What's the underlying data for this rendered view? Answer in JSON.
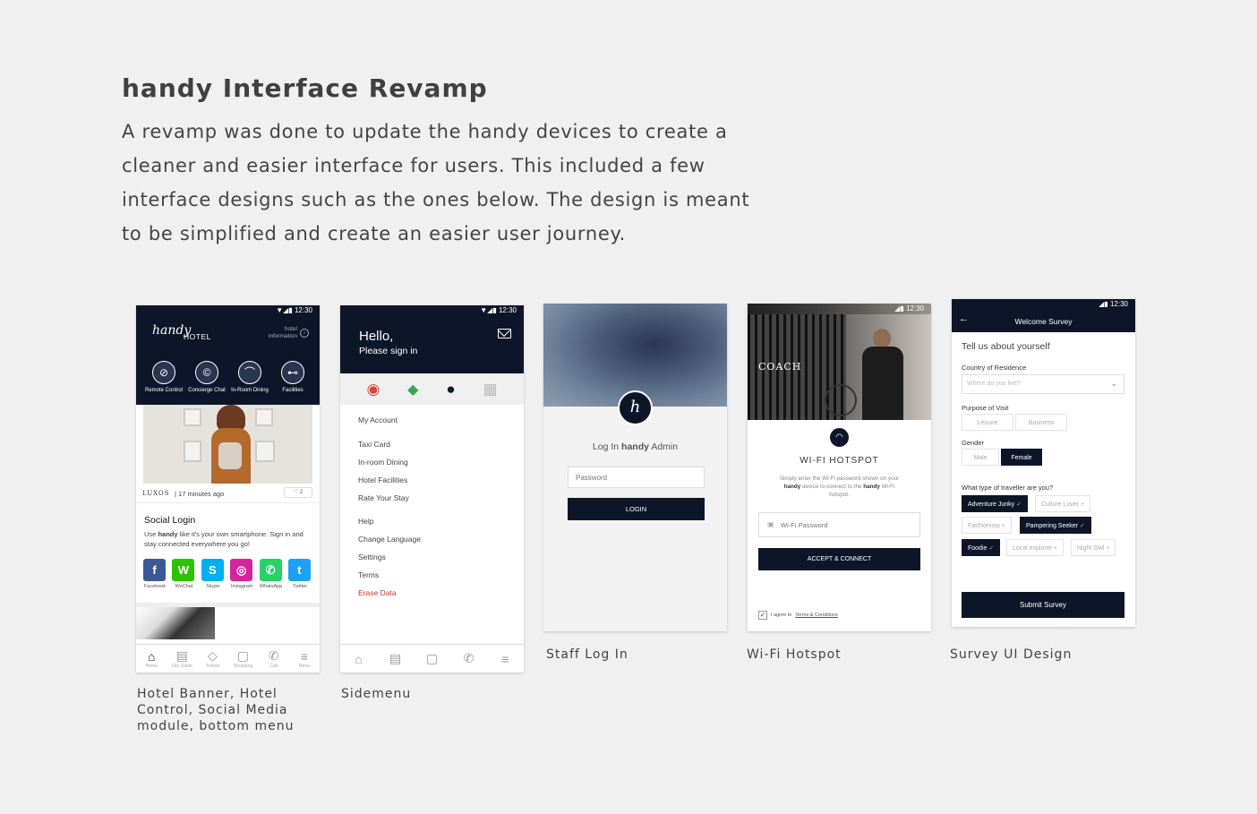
{
  "page": {
    "title": "handy Interface Revamp",
    "intro": "A revamp was done to update the handy devices to create a cleaner and easier interface for users. This included a few interface designs such as the ones below. The design is meant to be simplified and create an easier user journey."
  },
  "colors": {
    "navy": "#0d1629",
    "background": "#f0f0f0",
    "erase": "#c0392b"
  },
  "screen1": {
    "caption": "Hotel Banner, Hotel Control, Social Media module, bottom menu",
    "status_time": "12:30",
    "logo": "handy",
    "hotel_label": "HOTEL",
    "hotel_info": "hotel information",
    "controls": [
      {
        "label": "Remote Control",
        "icon": "remote-icon"
      },
      {
        "label": "Concierge Chat",
        "icon": "concierge-icon"
      },
      {
        "label": "In-Room Dining",
        "icon": "dining-icon"
      },
      {
        "label": "Facilities",
        "icon": "dumbbell-icon"
      }
    ],
    "banner_brand": "LUXOS",
    "banner_time": "17 minutes ago",
    "banner_likes": "2",
    "social_title": "Social Login",
    "social_text_pre": "Use",
    "social_text_brand": "handy",
    "social_text_post": "like it's your own smartphone. Sign in and stay connected everywhere you go!",
    "socials": [
      {
        "label": "Facebook",
        "glyph": "f",
        "color": "#3b5998",
        "icon": "facebook-icon"
      },
      {
        "label": "WeChat",
        "glyph": "W",
        "color": "#2dc100",
        "icon": "wechat-icon"
      },
      {
        "label": "Skype",
        "glyph": "S",
        "color": "#00aff0",
        "icon": "skype-icon"
      },
      {
        "label": "Instagram",
        "glyph": "◎",
        "color": "#d6249f",
        "icon": "instagram-icon"
      },
      {
        "label": "WhatsApp",
        "glyph": "✆",
        "color": "#25d366",
        "icon": "whatsapp-icon"
      },
      {
        "label": "Twitter",
        "glyph": "t",
        "color": "#1da1f2",
        "icon": "twitter-icon"
      }
    ],
    "nav": [
      {
        "label": "Home",
        "glyph": "⌂",
        "icon": "home-icon"
      },
      {
        "label": "City Guide",
        "glyph": "▤",
        "icon": "city-guide-icon"
      },
      {
        "label": "Tickets",
        "glyph": "◇",
        "icon": "tickets-icon"
      },
      {
        "label": "Shopping",
        "glyph": "▢",
        "icon": "shopping-icon"
      },
      {
        "label": "Call",
        "glyph": "✆",
        "icon": "call-icon"
      },
      {
        "label": "Menu",
        "glyph": "≡",
        "icon": "menu-icon"
      }
    ]
  },
  "screen2": {
    "caption": "Sidemenu",
    "status_time": "12:30",
    "hello": "Hello,",
    "sign_in": "Please sign in",
    "apps": [
      {
        "icon": "chrome-icon",
        "glyph": "◉",
        "color": "#db4437"
      },
      {
        "icon": "maps-icon",
        "glyph": "◆",
        "color": "#34a853"
      },
      {
        "icon": "handy-app-icon",
        "glyph": "●",
        "color": "#0d1629"
      },
      {
        "icon": "grid-app-icon",
        "glyph": "▦",
        "color": "#bbbbbb"
      }
    ],
    "menu_groups": [
      [
        "My Account"
      ],
      [
        "Taxi Card",
        "In-room Dining",
        "Hotel Facilities",
        "Rate Your Stay"
      ],
      [
        "Help",
        "Change Language",
        "Settings",
        "Terms"
      ]
    ],
    "erase": "Erase Data",
    "nav": [
      {
        "glyph": "⌂",
        "icon": "home-icon"
      },
      {
        "glyph": "▤",
        "icon": "city-guide-icon"
      },
      {
        "glyph": "▢",
        "icon": "shopping-icon"
      },
      {
        "glyph": "✆",
        "icon": "call-icon"
      },
      {
        "glyph": "≡",
        "icon": "menu-icon"
      }
    ]
  },
  "screen3": {
    "caption": "Staff Log In",
    "heading_pre": "Log In",
    "heading_brand": "handy",
    "heading_post": "Admin",
    "password_placeholder": "Password",
    "login": "LOGIN"
  },
  "screen4": {
    "caption": "Wi-Fi Hotspot",
    "status_time": "12:30",
    "brand": "COACH",
    "title": "WI-FI HOTSPOT",
    "desc_pre": "Simply enter the Wi-Fi password shown on your",
    "desc_brand": "handy",
    "desc_mid": "device to connect to the",
    "desc_brand2": "handy",
    "desc_post": "Wi-Fi hotspot.",
    "password_placeholder": "Wi-Fi Password",
    "accept": "ACCEPT & CONNECT",
    "agree_pre": "I agree to",
    "agree_link": "Terms & Conditions"
  },
  "screen5": {
    "caption": "Survey UI Design",
    "status_time": "12:30",
    "header": "Welcome Survey",
    "intro": "Tell us about yourself",
    "country_label": "Country of Residence",
    "country_placeholder": "Where do you live?",
    "purpose_label": "Purpose of Visit",
    "purpose": [
      "Leisure",
      "Business"
    ],
    "gender_label": "Gender",
    "gender": [
      "Male",
      "Female"
    ],
    "gender_selected": "Female",
    "traveller_label": "What type of traveller are you?",
    "traveller": [
      {
        "label": "Adventure Junky",
        "selected": true
      },
      {
        "label": "Culture Lover",
        "selected": false
      },
      {
        "label": "Fashionista",
        "selected": false
      },
      {
        "label": "Pampering Seeker",
        "selected": true
      },
      {
        "label": "Foodie",
        "selected": true
      },
      {
        "label": "Local explorer",
        "selected": false
      },
      {
        "label": "Night Owl",
        "selected": false
      }
    ],
    "submit": "Submit Survey"
  }
}
